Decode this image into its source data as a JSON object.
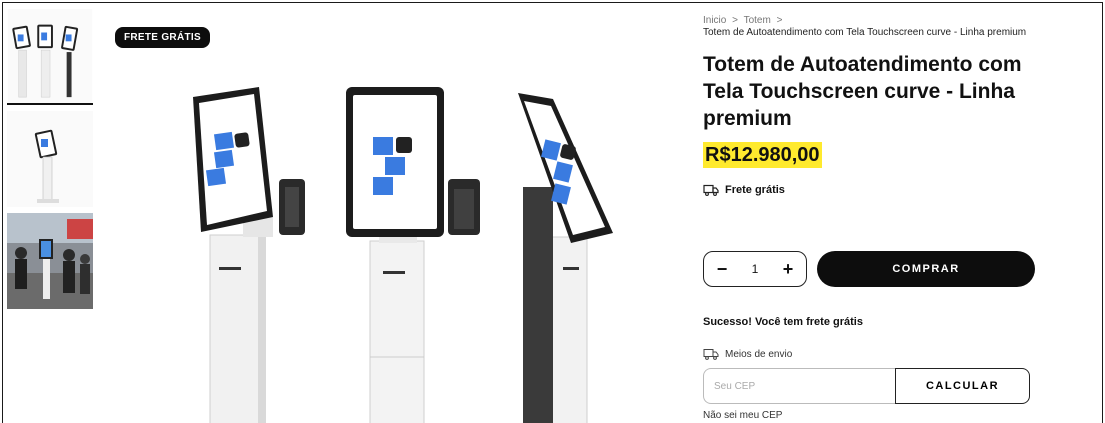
{
  "badge": {
    "label": "FRETE GRÁTIS"
  },
  "breadcrumb": {
    "items": [
      "Inicio",
      "Totem"
    ],
    "separator": ">",
    "current": "Totem de Autoatendimento com Tela Touchscreen curve - Linha premium"
  },
  "product": {
    "title": "Totem de Autoatendimento com Tela Touchscreen curve - Linha premium",
    "price": "R$12.980,00",
    "free_shipping_label": "Frete grátis"
  },
  "purchase": {
    "decrement": "−",
    "quantity": "1",
    "increment": "+",
    "buy_label": "COMPRAR"
  },
  "shipping": {
    "success_message": "Sucesso! Você tem frete grátis",
    "methods_label": "Meios de envio",
    "cep_placeholder": "Seu CEP",
    "calculate_label": "CALCULAR",
    "unknown_cep_link": "Não sei meu CEP"
  },
  "thumbnails": [
    {
      "name": "thumbnail-three-kiosks",
      "active": true
    },
    {
      "name": "thumbnail-single-kiosk",
      "active": false
    },
    {
      "name": "thumbnail-kiosk-in-use",
      "active": false
    }
  ],
  "colors": {
    "price_highlight": "#ffea2e",
    "button_dark": "#0d0d0d",
    "logo_blue": "#3a7be0"
  },
  "icons": {
    "truck": "truck-icon",
    "minus": "minus-icon",
    "plus": "plus-icon"
  }
}
